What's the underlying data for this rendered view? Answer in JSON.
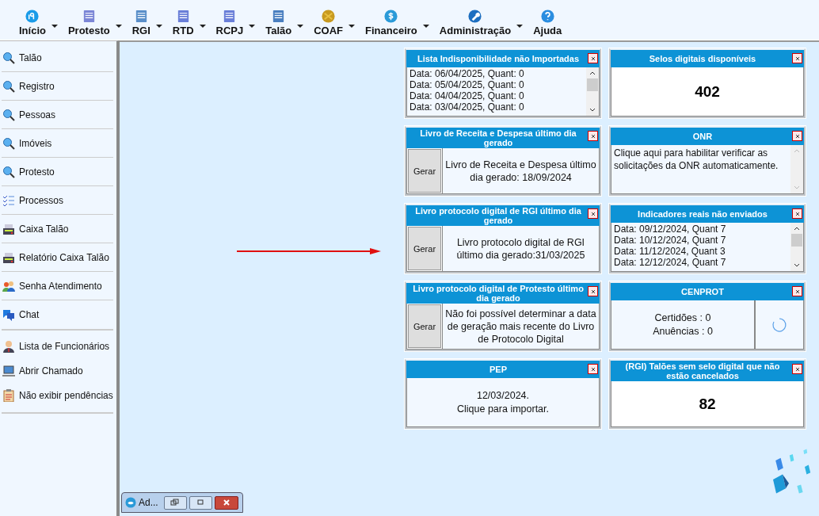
{
  "menu": [
    {
      "label": "Início",
      "caret": true
    },
    {
      "label": "Protesto",
      "caret": true
    },
    {
      "label": "RGI",
      "caret": true
    },
    {
      "label": "RTD",
      "caret": true
    },
    {
      "label": "RCPJ",
      "caret": true
    },
    {
      "label": "Talão",
      "caret": true
    },
    {
      "label": "COAF",
      "caret": true
    },
    {
      "label": "Financeiro",
      "caret": true
    },
    {
      "label": "Administração",
      "caret": true
    },
    {
      "label": "Ajuda",
      "caret": false
    }
  ],
  "sidebar": {
    "sections": [
      {
        "separated": true,
        "items": [
          "Talão",
          "Registro",
          "Pessoas",
          "Imóveis",
          "Protesto",
          "Processos",
          "Caixa Talão",
          "Relatório Caixa Talão",
          "Senha Atendimento",
          "Chat"
        ]
      },
      {
        "separated": false,
        "items": [
          "Lista de Funcionários",
          "Abrir Chamado",
          "Não exibir pendências"
        ]
      }
    ]
  },
  "panels": [
    {
      "kind": "list",
      "title": "Lista Indisponibilidade não Importadas",
      "lines": [
        "Data: 06/04/2025, Quant: 0",
        "Data: 05/04/2025, Quant: 0",
        "Data: 04/04/2025, Quant: 0",
        "Data: 03/04/2025, Quant: 0"
      ]
    },
    {
      "kind": "number",
      "title": "Selos digitais disponíveis",
      "value": "402"
    },
    {
      "kind": "generate",
      "title": "Livro de Receita e Despesa último dia gerado",
      "button": "Gerar",
      "text": "Livro de Receita e Despesa último dia gerado: 18/09/2024"
    },
    {
      "kind": "note",
      "title": "ONR",
      "text": "Clique aqui para habilitar verificar as solicitações da ONR automaticamente."
    },
    {
      "kind": "generate",
      "title": "Livro protocolo digital de RGI último dia gerado",
      "button": "Gerar",
      "text": "Livro protocolo digital de RGI último dia gerado:31/03/2025"
    },
    {
      "kind": "list",
      "title": "Indicadores reais não enviados",
      "lines": [
        "Data: 09/12/2024, Quant 7",
        "Data: 10/12/2024, Quant 7",
        "Data: 11/12/2024, Quant 3",
        "Data: 12/12/2024, Quant 7"
      ]
    },
    {
      "kind": "generate",
      "title": "Livro protocolo digital de Protesto último dia gerado",
      "button": "Gerar",
      "text": "Não foi possível determinar a data de geração mais recente do Livro de Protocolo Digital"
    },
    {
      "kind": "status",
      "title": "CENPROT",
      "lines": [
        "Certidões : 0",
        "Anuências : 0"
      ]
    },
    {
      "kind": "message",
      "title": "PEP",
      "lines": [
        "12/03/2024.",
        "Clique para importar."
      ]
    },
    {
      "kind": "number",
      "title": "(RGI) Talões sem selo digital que não estão cancelados",
      "value": "82"
    }
  ],
  "minimized_window": {
    "title": "Ad..."
  }
}
